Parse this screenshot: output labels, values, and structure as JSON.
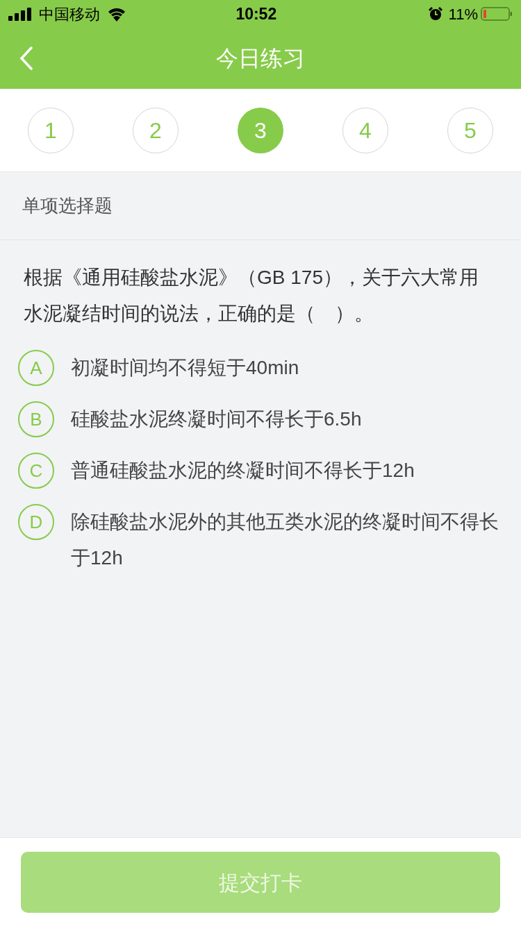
{
  "status_bar": {
    "carrier": "中国移动",
    "time": "10:52",
    "battery": "11%"
  },
  "header": {
    "title": "今日练习"
  },
  "question_nav": [
    {
      "label": "1",
      "selected": false
    },
    {
      "label": "2",
      "selected": false
    },
    {
      "label": "3",
      "selected": true
    },
    {
      "label": "4",
      "selected": false
    },
    {
      "label": "5",
      "selected": false
    }
  ],
  "section_title": "单项选择题",
  "question": "根据《通用硅酸盐水泥》（GB 175），关于六大常用水泥凝结时间的说法，正确的是（　）。",
  "options": [
    {
      "letter": "A",
      "text": "初凝时间均不得短于40min",
      "selected": false
    },
    {
      "letter": "B",
      "text": "硅酸盐水泥终凝时间不得长于6.5h",
      "selected": false
    },
    {
      "letter": "C",
      "text": "普通硅酸盐水泥的终凝时间不得长于12h",
      "selected": false
    },
    {
      "letter": "D",
      "text": "除硅酸盐水泥外的其他五类水泥的终凝时间不得长于12h",
      "selected": false
    }
  ],
  "submit": {
    "label": "提交打卡",
    "disabled": true
  }
}
